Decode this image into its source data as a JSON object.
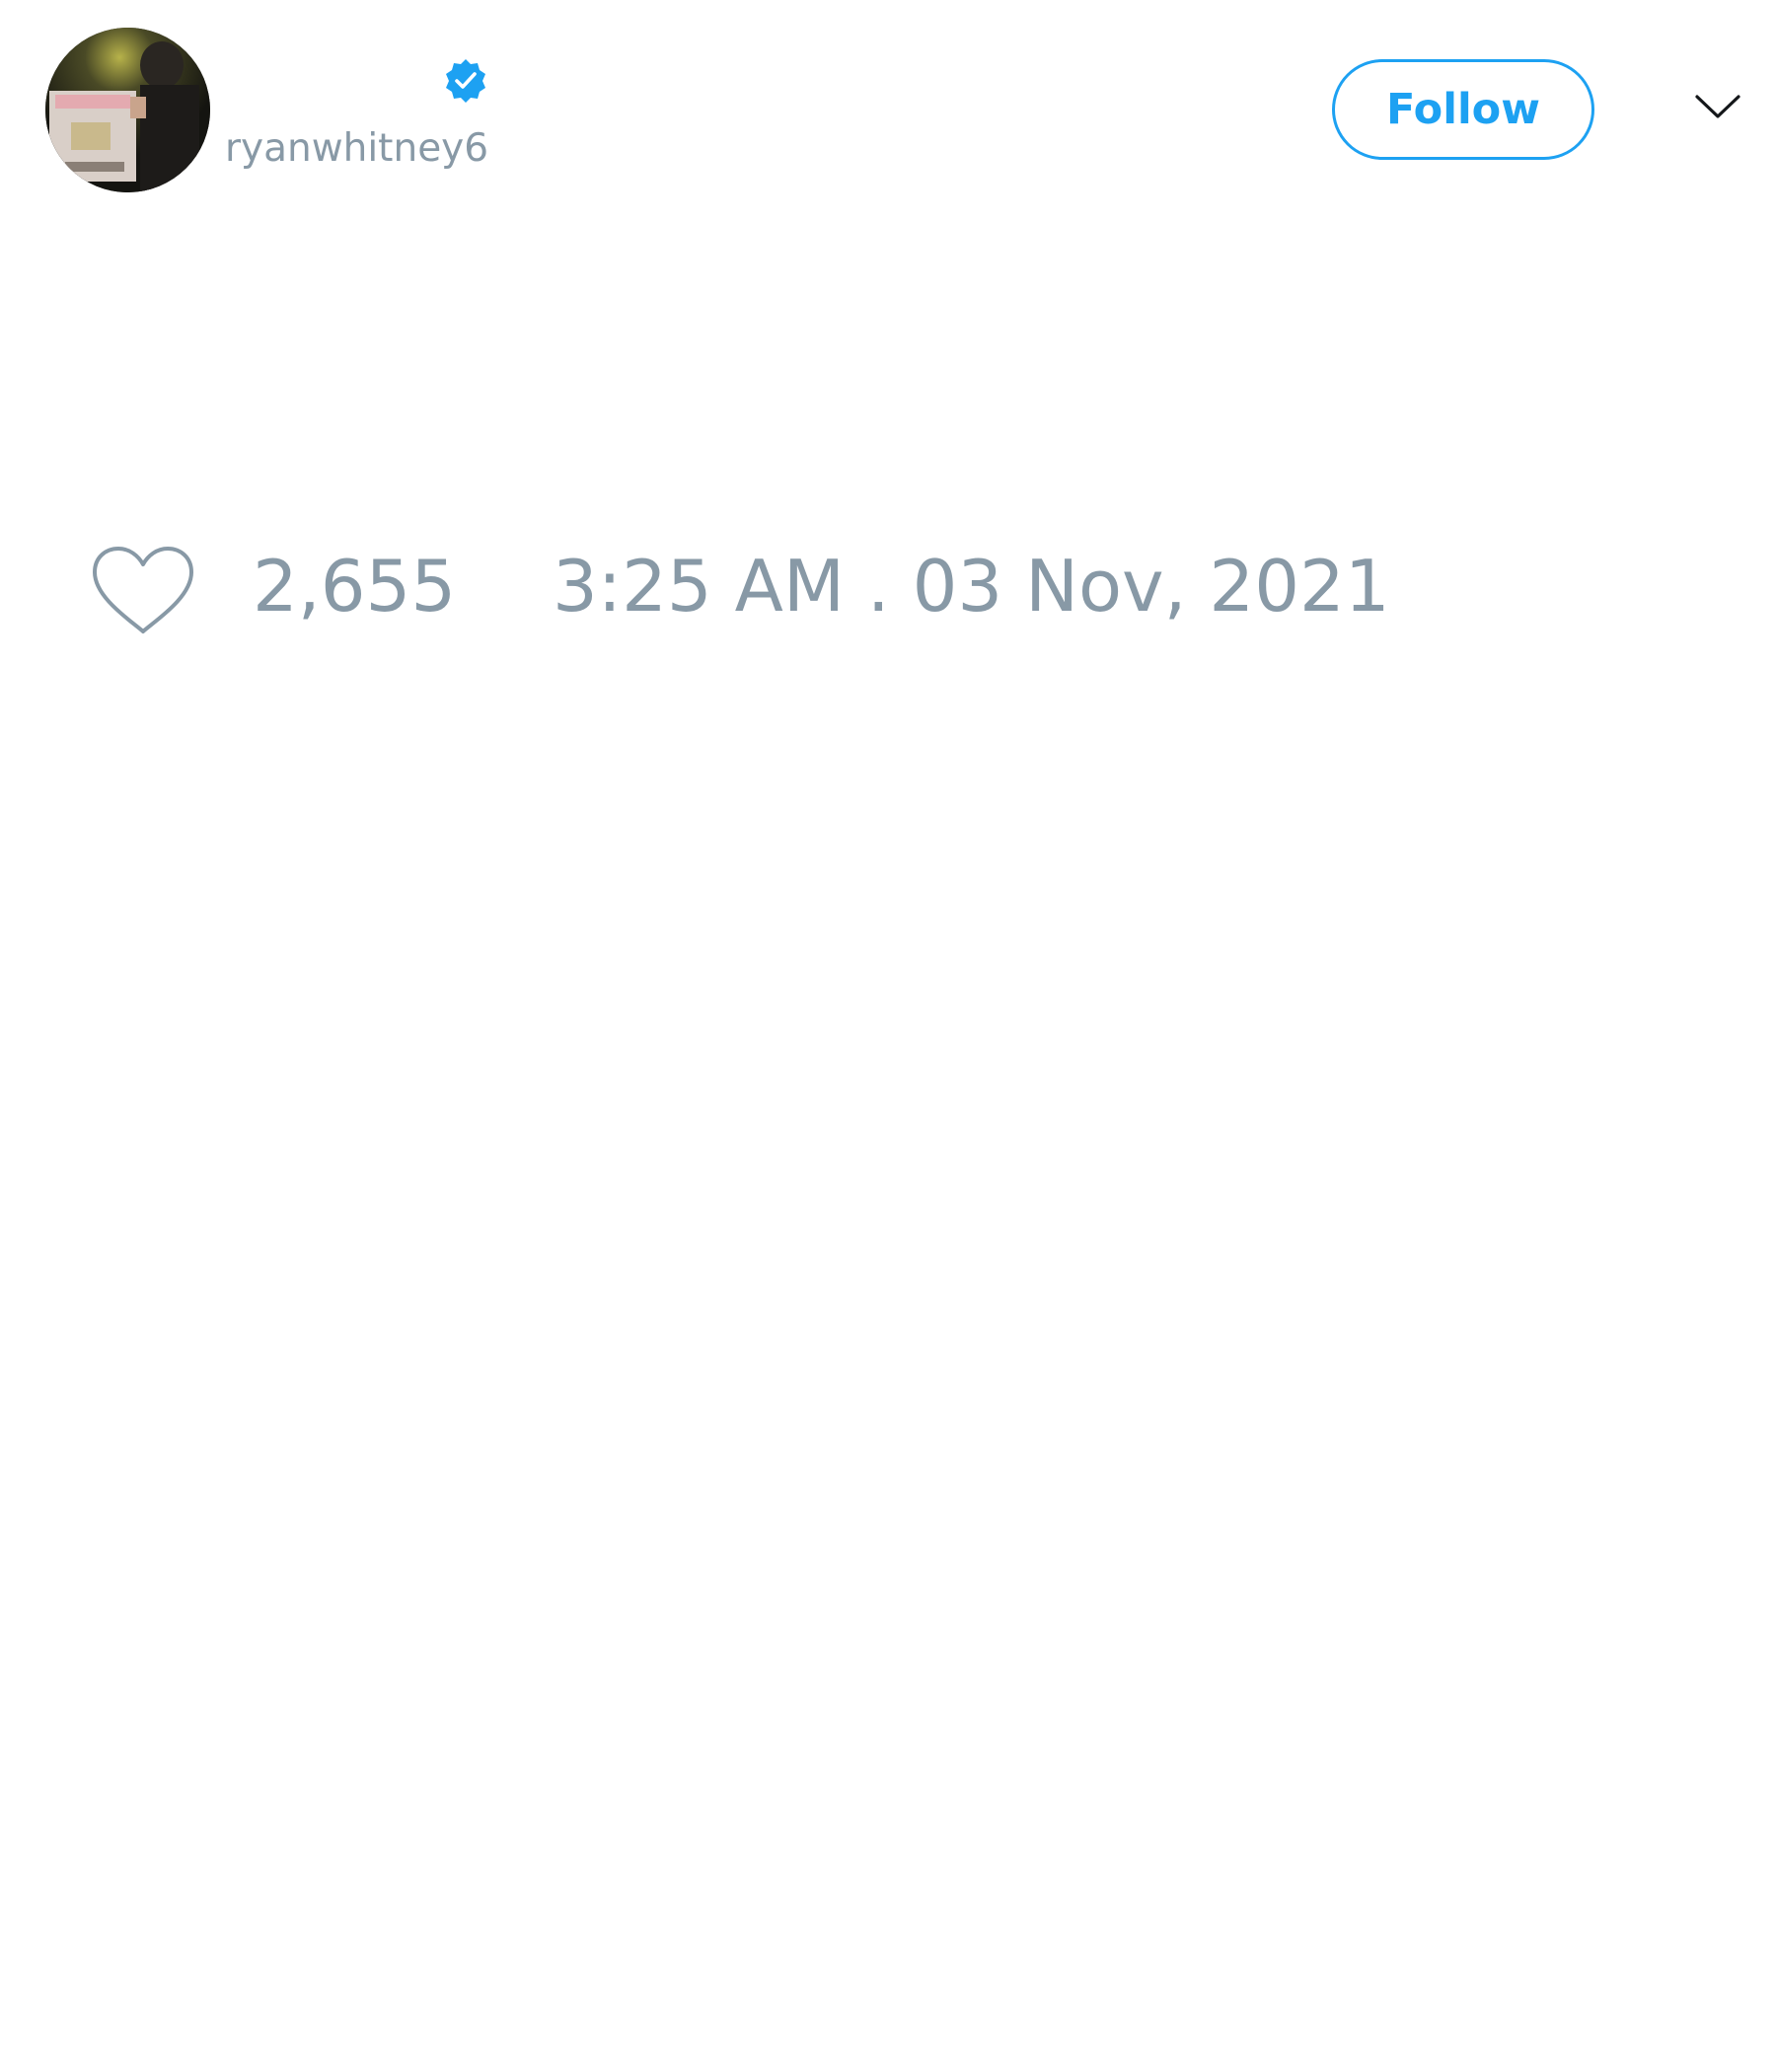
{
  "tweet": {
    "author": {
      "display_name": "",
      "handle": "ryanwhitney6",
      "verified": true,
      "avatar": "profile-photo"
    },
    "follow_label": "Follow",
    "menu_icon": "chevron-down-icon",
    "like_icon": "heart-icon",
    "like_count": "2,655",
    "timestamp": "3:25 AM . 03 Nov, 2021"
  },
  "colors": {
    "accent": "#1da1f2",
    "muted_text": "#8899a6",
    "background": "#ffffff"
  }
}
